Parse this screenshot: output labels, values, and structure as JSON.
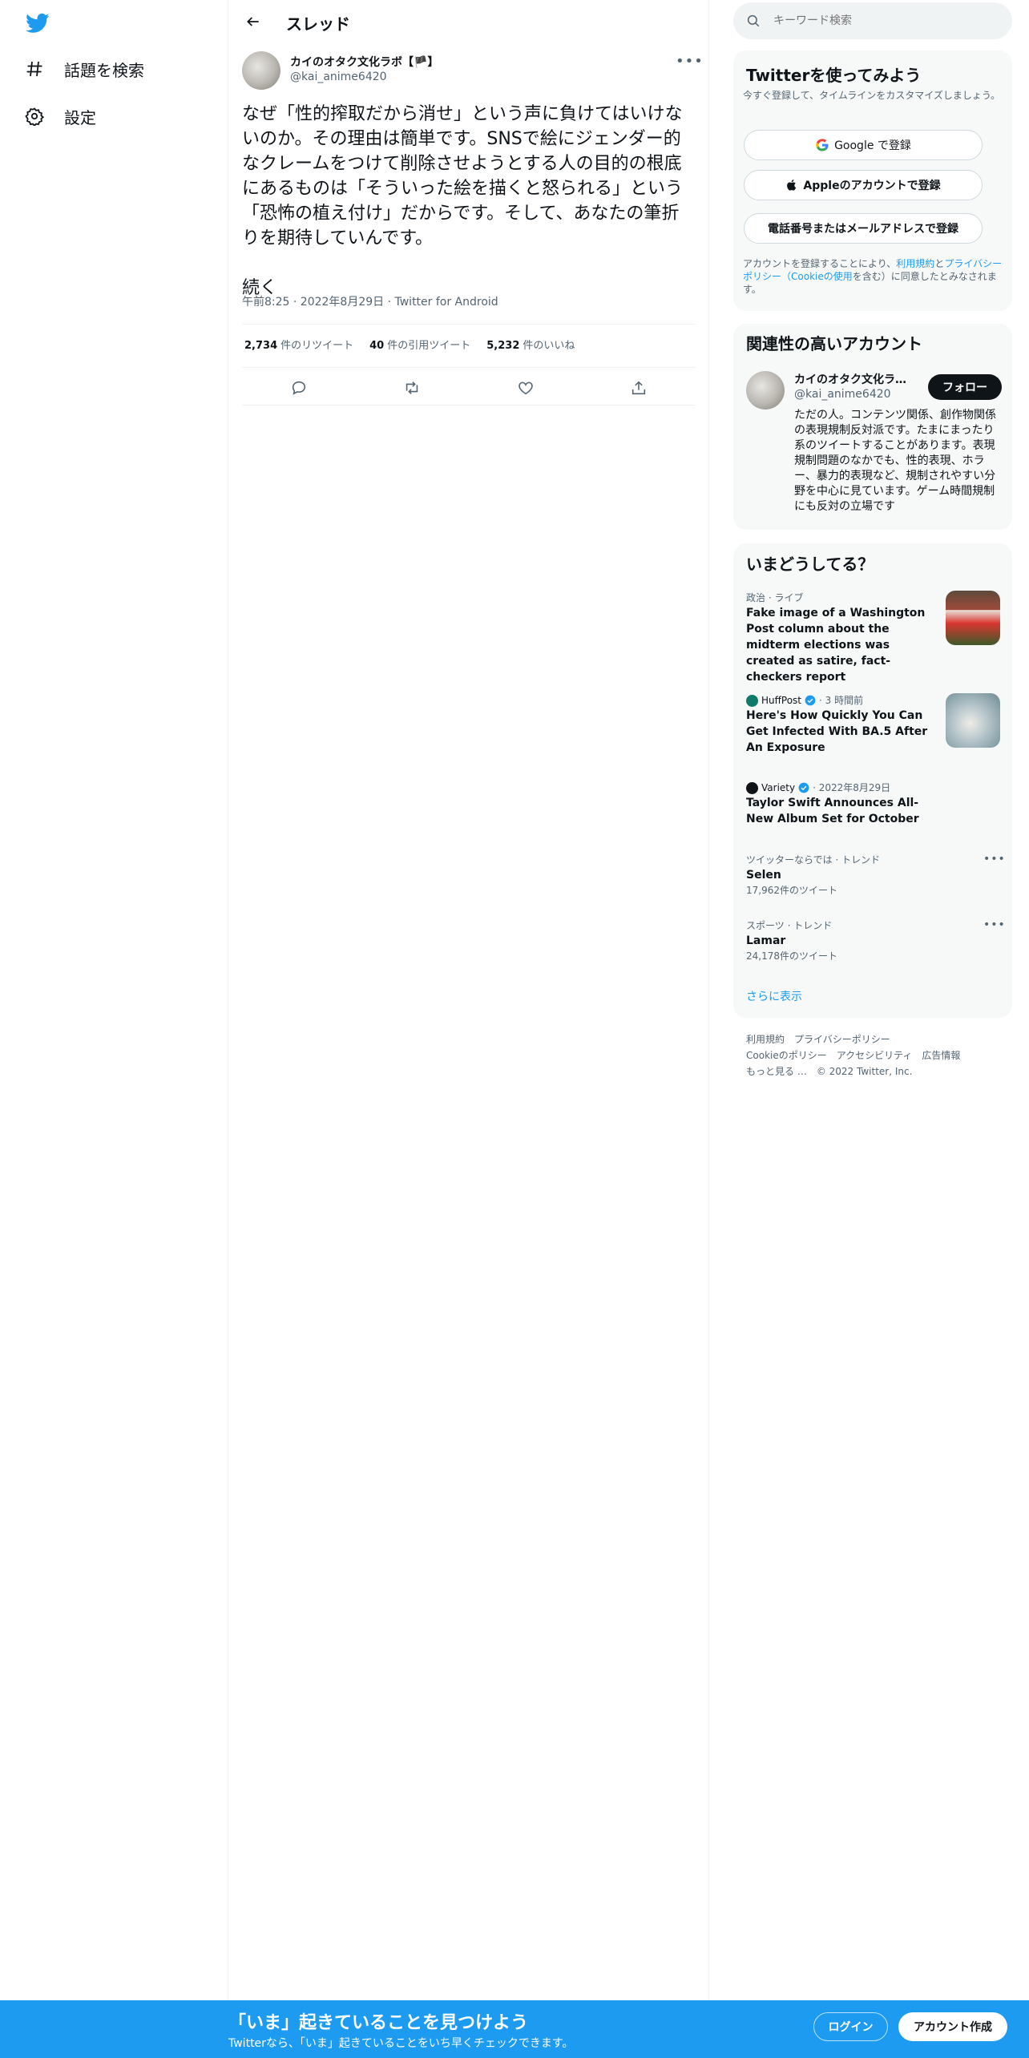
{
  "nav": {
    "logo": "twitter-bird-icon",
    "items": [
      {
        "icon": "hashtag-icon",
        "label": "話題を検索"
      },
      {
        "icon": "gear-icon",
        "label": "設定"
      }
    ]
  },
  "thread": {
    "title": "スレッド",
    "author": {
      "name": "カイのオタク文化ラボ【🏴】",
      "handle": "@kai_anime6420"
    },
    "text": "なぜ「性的搾取だから消せ」という声に負けてはいけないのか。その理由は簡単です。SNSで絵にジェンダー的なクレームをつけて削除させようとする人の目的の根底にあるものは「そういった絵を描くと怒られる」という「恐怖の植え付け」だからです。そして、あなたの筆折りを期待していんです。\n\n続く",
    "meta": "午前8:25 · 2022年8月29日 · Twitter for Android",
    "stats": {
      "retweets_count": "2,734",
      "retweets_label": "件のリツイート",
      "quotes_count": "40",
      "quotes_label": "件の引用ツイート",
      "likes_count": "5,232",
      "likes_label": "件のいいね"
    }
  },
  "search": {
    "placeholder": "キーワード検索"
  },
  "signup": {
    "title": "Twitterを使ってみよう",
    "subtitle": "今すぐ登録して、タイムラインをカスタマイズしましょう。",
    "google_label": "Google で登録",
    "apple_label": "Appleのアカウントで登録",
    "phone_label": "電話番号またはメールアドレスで登録",
    "terms_prefix": "アカウントを登録することにより、",
    "terms_link1": "利用規約",
    "terms_mid": "と",
    "terms_link2": "プライバシーポリシー（Cookieの使用",
    "terms_suffix": "を含む）に同意したとみなされます。"
  },
  "related": {
    "title": "関連性の高いアカウント",
    "name": "カイのオタク文化ラボ【🏴】",
    "handle": "@kai_anime6420",
    "follow_label": "フォロー",
    "bio": "ただの人。コンテンツ関係、創作物関係の表現規制反対派です。たまにまったり系のツイートすることがあります。表現規制問題のなかでも、性的表現、ホラー、暴力的表現など、規制されやすい分野を中心に見ています。ゲーム時間規制にも反対の立場です"
  },
  "trends": {
    "title": "いまどうしてる？",
    "items": [
      {
        "category": "政治 · ライブ",
        "text": "Fake image of a Washington Post column about the midterm elections was created as satire, fact-checkers report"
      },
      {
        "publisher": "HuffPost",
        "time": "· 3 時間前",
        "text": "Here's How Quickly You Can Get Infected With BA.5 After An Exposure"
      },
      {
        "publisher": "Variety",
        "time": "· 2022年8月29日",
        "text": "Taylor Swift Announces All-New Album Set for October"
      },
      {
        "category": "ツイッターならでは · トレンド",
        "text": "Selen",
        "count": "17,962件のツイート"
      },
      {
        "category": "スポーツ · トレンド",
        "text": "Lamar",
        "count": "24,178件のツイート"
      }
    ],
    "show_more": "さらに表示"
  },
  "footer": {
    "links": [
      "利用規約",
      "プライバシーポリシー",
      "Cookieのポリシー",
      "アクセシビリティ",
      "広告情報",
      "もっと見る …",
      "© 2022 Twitter, Inc."
    ]
  },
  "banner": {
    "title": "「いま」起きていることを見つけよう",
    "subtitle": "Twitterなら、「いま」起きていることをいち早くチェックできます。",
    "login_label": "ログイン",
    "signup_label": "アカウント作成"
  },
  "colors": {
    "brand": "#1d9bf0",
    "text": "#0f1419",
    "secondary": "#536471"
  }
}
